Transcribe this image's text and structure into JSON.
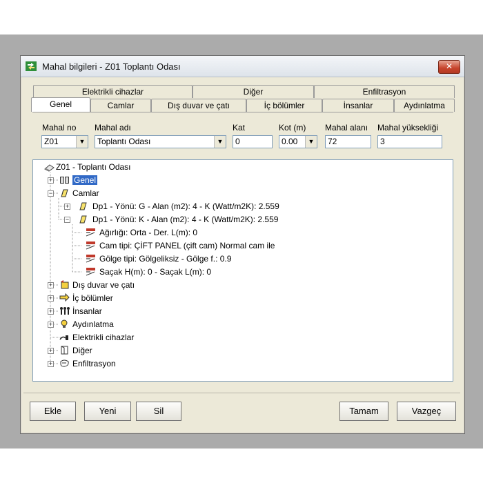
{
  "window": {
    "title": "Mahal bilgileri - Z01 Toplantı Odası",
    "close": "✕"
  },
  "tabs": {
    "back_row": [
      "Elektrikli cihazlar",
      "Diğer",
      "Enfiltrasyon"
    ],
    "front_row": [
      "Genel",
      "Camlar",
      "Dış duvar ve çatı",
      "İç bölümler",
      "İnsanlar",
      "Aydınlatma"
    ],
    "active": "Genel"
  },
  "fields": {
    "mahal_no": {
      "label": "Mahal no",
      "value": "Z01"
    },
    "mahal_adi": {
      "label": "Mahal adı",
      "value": "Toplantı Odası"
    },
    "kat": {
      "label": "Kat",
      "value": "0"
    },
    "kot": {
      "label": "Kot (m)",
      "value": "0.00"
    },
    "mahal_alani": {
      "label": "Mahal alanı",
      "value": "72"
    },
    "mahal_yuksekligi": {
      "label": "Mahal yüksekliği",
      "value": "3"
    }
  },
  "tree": {
    "root": "Z01 - Toplantı Odası",
    "genel": "Genel",
    "camlar": "Camlar",
    "dp1_g": "Dp1 - Yönü: G - Alan (m2): 4 - K (Watt/m2K): 2.559",
    "dp1_k": "Dp1 - Yönü: K - Alan (m2): 4 - K (Watt/m2K): 2.559",
    "agirlik": "Ağırlığı: Orta - Der. L(m): 0",
    "cam_tipi": "Cam tipi: ÇİFT PANEL (çift cam) Normal cam ile",
    "golge_tipi": "Gölge tipi: Gölgeliksiz - Gölge f.: 0.9",
    "sacak": "Saçak H(m): 0 - Saçak L(m): 0",
    "dis_duvar": "Dış duvar ve çatı",
    "ic_bolumler": "İç bölümler",
    "insanlar": "İnsanlar",
    "aydinlatma": "Aydınlatma",
    "elektrikli": "Elektrikli cihazlar",
    "diger": "Diğer",
    "enfiltrasyon": "Enfiltrasyon"
  },
  "buttons": {
    "ekle": "Ekle",
    "yeni": "Yeni",
    "sil": "Sil",
    "tamam": "Tamam",
    "vazgec": "Vazgeç"
  },
  "colors": {
    "selection": "#3169c6",
    "dialog_bg": "#ece9d8",
    "close_red": "#c7432c"
  }
}
